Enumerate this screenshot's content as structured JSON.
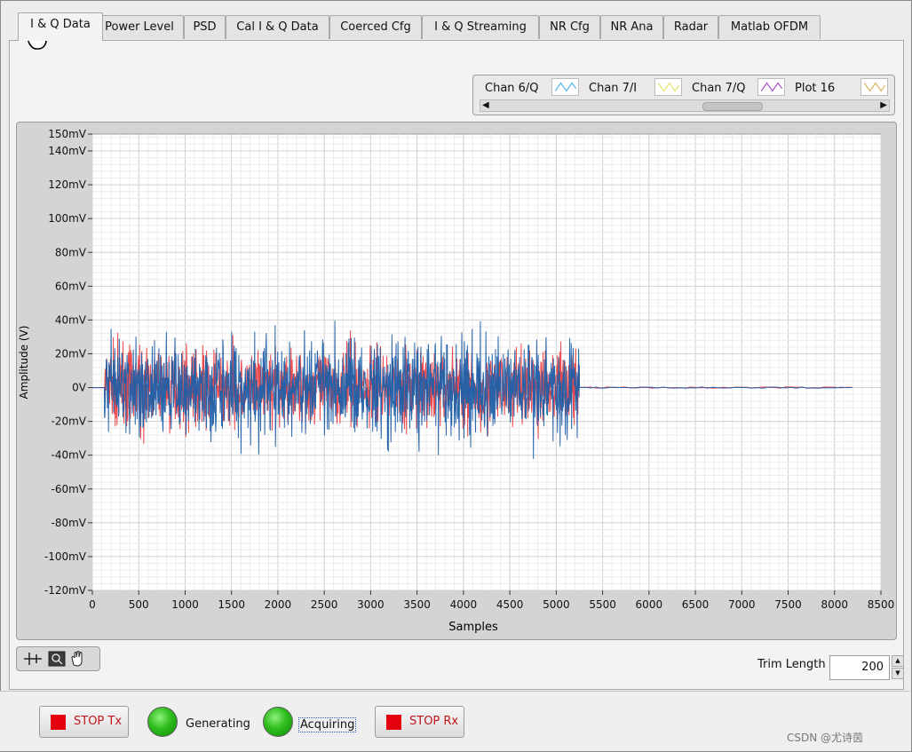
{
  "tabs": [
    {
      "label": "I & Q Data",
      "active": true
    },
    {
      "label": "Power Level"
    },
    {
      "label": "PSD"
    },
    {
      "label": "Cal I & Q Data"
    },
    {
      "label": "Coerced Cfg"
    },
    {
      "label": "I & Q Streaming"
    },
    {
      "label": "NR Cfg"
    },
    {
      "label": "NR Ana"
    },
    {
      "label": "Radar"
    },
    {
      "label": "Matlab OFDM"
    }
  ],
  "legend": {
    "items": [
      {
        "label": "Chan 6/Q",
        "color": "#4fb3e8"
      },
      {
        "label": "Chan 7/I",
        "color": "#e6e36a"
      },
      {
        "label": "Chan 7/Q",
        "color": "#a64ec4"
      },
      {
        "label": "Plot 16",
        "color": "#d8b45a"
      }
    ]
  },
  "chart_data": {
    "type": "line",
    "xlabel": "Samples",
    "ylabel": "Amplitude (V)",
    "xlim": [
      0,
      8500
    ],
    "ylim": [
      -0.12,
      0.15
    ],
    "x_ticks": [
      "0",
      "500",
      "1000",
      "1500",
      "2000",
      "2500",
      "3000",
      "3500",
      "4000",
      "4500",
      "5000",
      "5500",
      "6000",
      "6500",
      "7000",
      "7500",
      "8000",
      "8500"
    ],
    "y_ticks": [
      "150mV",
      "140mV",
      "120mV",
      "100mV",
      "80mV",
      "60mV",
      "40mV",
      "20mV",
      "0V",
      "-20mV",
      "-40mV",
      "-60mV",
      "-80mV",
      "-100mV",
      "-120mV"
    ],
    "y_tick_values": [
      0.15,
      0.14,
      0.12,
      0.1,
      0.08,
      0.06,
      0.04,
      0.02,
      0,
      -0.02,
      -0.04,
      -0.06,
      -0.08,
      -0.1,
      -0.12
    ],
    "grid": true,
    "series": [
      {
        "color": "#e8373b",
        "signal_start": 130,
        "signal_end": 5250,
        "data_end": 8190,
        "peak": 0.04
      },
      {
        "color": "#1f5fa8",
        "signal_start": 130,
        "signal_end": 5250,
        "data_end": 8190,
        "peak": 0.05
      }
    ],
    "plot_bg": "#ffffff"
  },
  "trim": {
    "label": "Trim Length",
    "value": "200"
  },
  "controls": {
    "stop_tx": "STOP Tx",
    "generating": "Generating",
    "acquiring": "Acquiring",
    "stop_rx": "STOP Rx"
  },
  "watermark": "CSDN @尤诗茵"
}
